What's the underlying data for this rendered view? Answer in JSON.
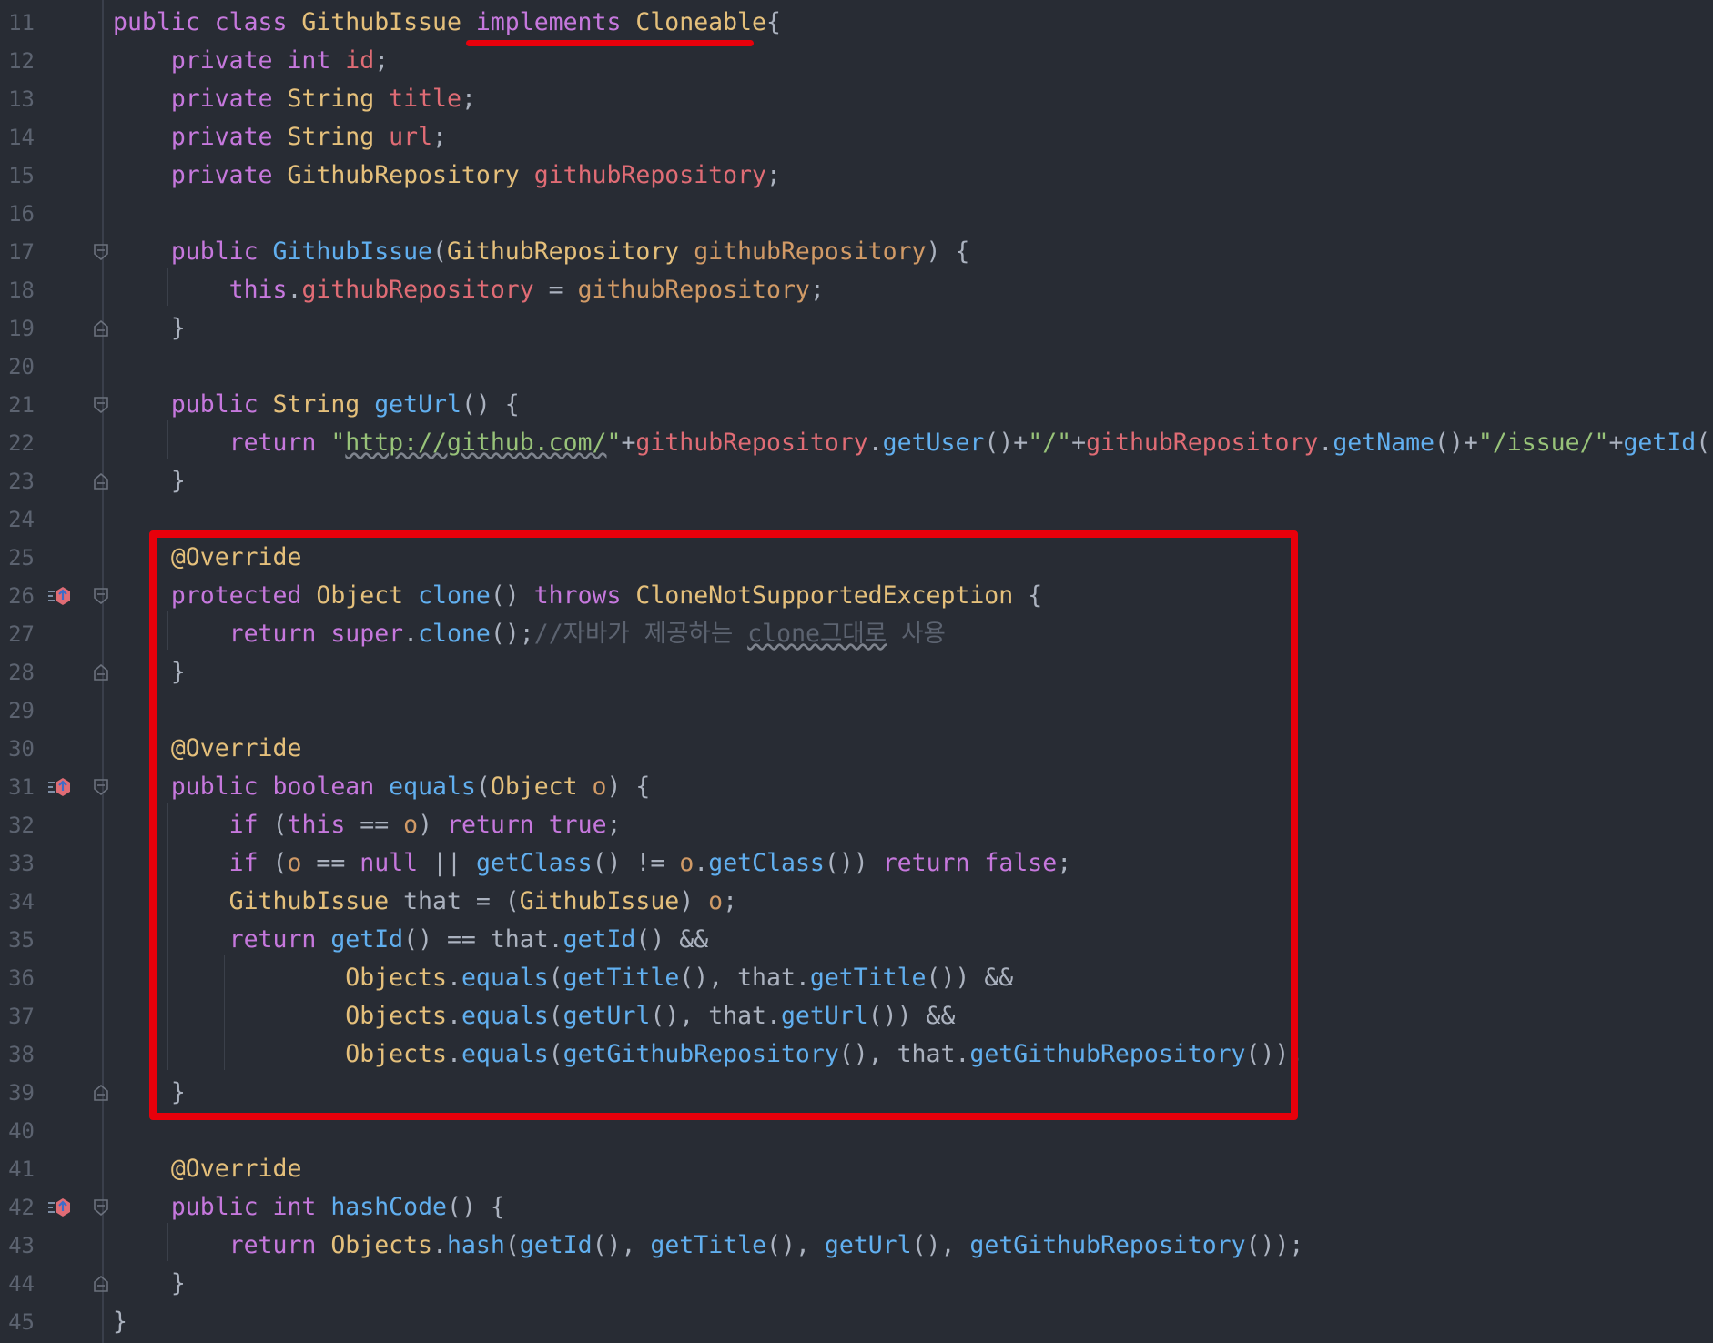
{
  "editor": {
    "lines": [
      {
        "n": "11",
        "tokens": [
          [
            "kw",
            "public "
          ],
          [
            "kw",
            "class "
          ],
          [
            "ty",
            "GithubIssue "
          ],
          [
            "kw",
            "implements "
          ],
          [
            "ty",
            "Cloneable"
          ],
          [
            "pl",
            "{"
          ]
        ]
      },
      {
        "n": "12",
        "tokens": [
          [
            "pl",
            "    "
          ],
          [
            "kw",
            "private "
          ],
          [
            "kw",
            "int "
          ],
          [
            "fd",
            "id"
          ],
          [
            "pl",
            ";"
          ]
        ]
      },
      {
        "n": "13",
        "tokens": [
          [
            "pl",
            "    "
          ],
          [
            "kw",
            "private "
          ],
          [
            "ty",
            "String "
          ],
          [
            "fd",
            "title"
          ],
          [
            "pl",
            ";"
          ]
        ]
      },
      {
        "n": "14",
        "tokens": [
          [
            "pl",
            "    "
          ],
          [
            "kw",
            "private "
          ],
          [
            "ty",
            "String "
          ],
          [
            "fd",
            "url"
          ],
          [
            "pl",
            ";"
          ]
        ]
      },
      {
        "n": "15",
        "tokens": [
          [
            "pl",
            "    "
          ],
          [
            "kw",
            "private "
          ],
          [
            "ty",
            "GithubRepository "
          ],
          [
            "fd",
            "githubRepository"
          ],
          [
            "pl",
            ";"
          ]
        ]
      },
      {
        "n": "16",
        "tokens": []
      },
      {
        "n": "17",
        "tokens": [
          [
            "pl",
            "    "
          ],
          [
            "kw",
            "public "
          ],
          [
            "fn",
            "GithubIssue"
          ],
          [
            "pl",
            "("
          ],
          [
            "ty",
            "GithubRepository "
          ],
          [
            "pm",
            "githubRepository"
          ],
          [
            "pl",
            ") {"
          ]
        ]
      },
      {
        "n": "18",
        "tokens": [
          [
            "pl",
            "        "
          ],
          [
            "kw",
            "this"
          ],
          [
            "pl",
            "."
          ],
          [
            "fd",
            "githubRepository"
          ],
          [
            "pl",
            " = "
          ],
          [
            "pm",
            "githubRepository"
          ],
          [
            "pl",
            ";"
          ]
        ]
      },
      {
        "n": "19",
        "tokens": [
          [
            "pl",
            "    }"
          ]
        ]
      },
      {
        "n": "20",
        "tokens": []
      },
      {
        "n": "21",
        "tokens": [
          [
            "pl",
            "    "
          ],
          [
            "kw",
            "public "
          ],
          [
            "ty",
            "String "
          ],
          [
            "fn",
            "getUrl"
          ],
          [
            "pl",
            "() {"
          ]
        ]
      },
      {
        "n": "22",
        "tokens": [
          [
            "pl",
            "        "
          ],
          [
            "kw",
            "return "
          ],
          [
            "st",
            "\""
          ],
          [
            "stu",
            "http://github.com/"
          ],
          [
            "st",
            "\""
          ],
          [
            "pl",
            "+"
          ],
          [
            "fd",
            "githubRepository"
          ],
          [
            "pl",
            "."
          ],
          [
            "fn",
            "getUser"
          ],
          [
            "pl",
            "()+"
          ],
          [
            "st",
            "\"/\""
          ],
          [
            "pl",
            "+"
          ],
          [
            "fd",
            "githubRepository"
          ],
          [
            "pl",
            "."
          ],
          [
            "fn",
            "getName"
          ],
          [
            "pl",
            "()+"
          ],
          [
            "st",
            "\"/issue/\""
          ],
          [
            "pl",
            "+"
          ],
          [
            "fn",
            "getId"
          ],
          [
            "pl",
            "();"
          ]
        ]
      },
      {
        "n": "23",
        "tokens": [
          [
            "pl",
            "    }"
          ]
        ]
      },
      {
        "n": "24",
        "tokens": []
      },
      {
        "n": "25",
        "tokens": [
          [
            "pl",
            "    "
          ],
          [
            "an",
            "@Override"
          ]
        ]
      },
      {
        "n": "26",
        "tokens": [
          [
            "pl",
            "    "
          ],
          [
            "kw",
            "protected "
          ],
          [
            "ty",
            "Object "
          ],
          [
            "fn",
            "clone"
          ],
          [
            "pl",
            "() "
          ],
          [
            "kw",
            "throws "
          ],
          [
            "ty",
            "CloneNotSupportedException "
          ],
          [
            "pl",
            "{"
          ]
        ]
      },
      {
        "n": "27",
        "tokens": [
          [
            "pl",
            "        "
          ],
          [
            "kw",
            "return "
          ],
          [
            "kw",
            "super"
          ],
          [
            "pl",
            "."
          ],
          [
            "fn",
            "clone"
          ],
          [
            "pl",
            "();"
          ],
          [
            "cm",
            "//자바가 제공하는 "
          ],
          [
            "cmu",
            "clone그대로"
          ],
          [
            "cm",
            " 사용"
          ]
        ]
      },
      {
        "n": "28",
        "tokens": [
          [
            "pl",
            "    }"
          ]
        ]
      },
      {
        "n": "29",
        "tokens": []
      },
      {
        "n": "30",
        "tokens": [
          [
            "pl",
            "    "
          ],
          [
            "an",
            "@Override"
          ]
        ]
      },
      {
        "n": "31",
        "tokens": [
          [
            "pl",
            "    "
          ],
          [
            "kw",
            "public "
          ],
          [
            "kw",
            "boolean "
          ],
          [
            "fn",
            "equals"
          ],
          [
            "pl",
            "("
          ],
          [
            "ty",
            "Object "
          ],
          [
            "pm",
            "o"
          ],
          [
            "pl",
            ") {"
          ]
        ]
      },
      {
        "n": "32",
        "tokens": [
          [
            "pl",
            "        "
          ],
          [
            "kw",
            "if "
          ],
          [
            "pl",
            "("
          ],
          [
            "kw",
            "this"
          ],
          [
            "pl",
            " == "
          ],
          [
            "pm",
            "o"
          ],
          [
            "pl",
            ") "
          ],
          [
            "kw",
            "return "
          ],
          [
            "kw",
            "true"
          ],
          [
            "pl",
            ";"
          ]
        ]
      },
      {
        "n": "33",
        "tokens": [
          [
            "pl",
            "        "
          ],
          [
            "kw",
            "if "
          ],
          [
            "pl",
            "("
          ],
          [
            "pm",
            "o"
          ],
          [
            "pl",
            " == "
          ],
          [
            "kw",
            "null"
          ],
          [
            "pl",
            " || "
          ],
          [
            "fn",
            "getClass"
          ],
          [
            "pl",
            "() != "
          ],
          [
            "pm",
            "o"
          ],
          [
            "pl",
            "."
          ],
          [
            "fn",
            "getClass"
          ],
          [
            "pl",
            "()) "
          ],
          [
            "kw",
            "return "
          ],
          [
            "kw",
            "false"
          ],
          [
            "pl",
            ";"
          ]
        ]
      },
      {
        "n": "34",
        "tokens": [
          [
            "pl",
            "        "
          ],
          [
            "ty",
            "GithubIssue "
          ],
          [
            "pl",
            "that = ("
          ],
          [
            "ty",
            "GithubIssue"
          ],
          [
            "pl",
            ") "
          ],
          [
            "pm",
            "o"
          ],
          [
            "pl",
            ";"
          ]
        ]
      },
      {
        "n": "35",
        "tokens": [
          [
            "pl",
            "        "
          ],
          [
            "kw",
            "return "
          ],
          [
            "fn",
            "getId"
          ],
          [
            "pl",
            "() == that."
          ],
          [
            "fn",
            "getId"
          ],
          [
            "pl",
            "() &&"
          ]
        ]
      },
      {
        "n": "36",
        "tokens": [
          [
            "pl",
            "                "
          ],
          [
            "ty",
            "Objects"
          ],
          [
            "pl",
            "."
          ],
          [
            "fn",
            "equals"
          ],
          [
            "pl",
            "("
          ],
          [
            "fn",
            "getTitle"
          ],
          [
            "pl",
            "(), that."
          ],
          [
            "fn",
            "getTitle"
          ],
          [
            "pl",
            "()) &&"
          ]
        ]
      },
      {
        "n": "37",
        "tokens": [
          [
            "pl",
            "                "
          ],
          [
            "ty",
            "Objects"
          ],
          [
            "pl",
            "."
          ],
          [
            "fn",
            "equals"
          ],
          [
            "pl",
            "("
          ],
          [
            "fn",
            "getUrl"
          ],
          [
            "pl",
            "(), that."
          ],
          [
            "fn",
            "getUrl"
          ],
          [
            "pl",
            "()) &&"
          ]
        ]
      },
      {
        "n": "38",
        "tokens": [
          [
            "pl",
            "                "
          ],
          [
            "ty",
            "Objects"
          ],
          [
            "pl",
            "."
          ],
          [
            "fn",
            "equals"
          ],
          [
            "pl",
            "("
          ],
          [
            "fn",
            "getGithubRepository"
          ],
          [
            "pl",
            "(), that."
          ],
          [
            "fn",
            "getGithubRepository"
          ],
          [
            "pl",
            "());"
          ]
        ]
      },
      {
        "n": "39",
        "tokens": [
          [
            "pl",
            "    }"
          ]
        ]
      },
      {
        "n": "40",
        "tokens": []
      },
      {
        "n": "41",
        "tokens": [
          [
            "pl",
            "    "
          ],
          [
            "an",
            "@Override"
          ]
        ]
      },
      {
        "n": "42",
        "tokens": [
          [
            "pl",
            "    "
          ],
          [
            "kw",
            "public "
          ],
          [
            "kw",
            "int "
          ],
          [
            "fn",
            "hashCode"
          ],
          [
            "pl",
            "() {"
          ]
        ]
      },
      {
        "n": "43",
        "tokens": [
          [
            "pl",
            "        "
          ],
          [
            "kw",
            "return "
          ],
          [
            "ty",
            "Objects"
          ],
          [
            "pl",
            "."
          ],
          [
            "fn",
            "hash"
          ],
          [
            "pl",
            "("
          ],
          [
            "fn",
            "getId"
          ],
          [
            "pl",
            "(), "
          ],
          [
            "fn",
            "getTitle"
          ],
          [
            "pl",
            "(), "
          ],
          [
            "fn",
            "getUrl"
          ],
          [
            "pl",
            "(), "
          ],
          [
            "fn",
            "getGithubRepository"
          ],
          [
            "pl",
            "());"
          ]
        ]
      },
      {
        "n": "44",
        "tokens": [
          [
            "pl",
            "    }"
          ]
        ]
      },
      {
        "n": "45",
        "tokens": [
          [
            "pl",
            "}"
          ]
        ]
      }
    ],
    "fold_markers": [
      "17",
      "19",
      "21",
      "23",
      "26",
      "28",
      "31",
      "39",
      "42",
      "44"
    ],
    "override_markers": [
      "26",
      "31",
      "42"
    ],
    "highlight_color": "#e8000b",
    "background": "#282c34"
  }
}
